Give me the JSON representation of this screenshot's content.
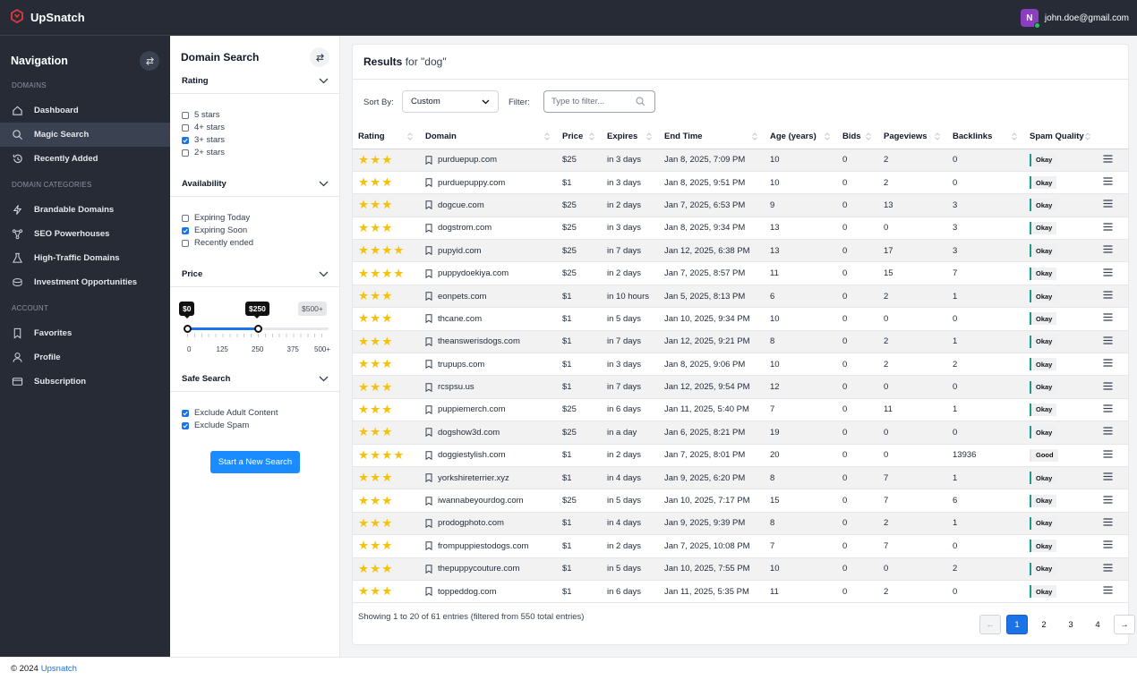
{
  "app": {
    "name": "UpSnatch"
  },
  "user": {
    "initial": "N",
    "email": "john.doe@gmail.com"
  },
  "nav": {
    "title": "Navigation",
    "sections": [
      {
        "label": "DOMAINS",
        "items": [
          {
            "label": "Dashboard",
            "icon": "home-icon"
          },
          {
            "label": "Magic Search",
            "icon": "search-icon",
            "active": true
          },
          {
            "label": "Recently Added",
            "icon": "history-icon"
          }
        ]
      },
      {
        "label": "DOMAIN CATEGORIES",
        "items": [
          {
            "label": "Brandable Domains",
            "icon": "lightning-icon"
          },
          {
            "label": "SEO Powerhouses",
            "icon": "network-icon"
          },
          {
            "label": "High-Traffic Domains",
            "icon": "flask-icon"
          },
          {
            "label": "Investment Opportunities",
            "icon": "coins-icon"
          }
        ]
      },
      {
        "label": "ACCOUNT",
        "items": [
          {
            "label": "Favorites",
            "icon": "bookmark-icon"
          },
          {
            "label": "Profile",
            "icon": "user-icon"
          },
          {
            "label": "Subscription",
            "icon": "card-icon"
          }
        ]
      }
    ]
  },
  "filters": {
    "title": "Domain Search",
    "rating": {
      "title": "Rating",
      "options": [
        {
          "label": "5 stars",
          "checked": false
        },
        {
          "label": "4+ stars",
          "checked": false
        },
        {
          "label": "3+ stars",
          "checked": true
        },
        {
          "label": "2+ stars",
          "checked": false
        }
      ]
    },
    "availability": {
      "title": "Availability",
      "options": [
        {
          "label": "Expiring Today",
          "checked": false
        },
        {
          "label": "Expiring Soon",
          "checked": true
        },
        {
          "label": "Recently ended",
          "checked": false
        }
      ]
    },
    "price": {
      "title": "Price",
      "min_label": "$0",
      "max_label": "$250",
      "cap_label": "$500+",
      "min": 0,
      "max": 250,
      "scale_max": 500,
      "ticks": [
        "0",
        "125",
        "250",
        "375",
        "500+"
      ]
    },
    "safe": {
      "title": "Safe Search",
      "options": [
        {
          "label": "Exclude Adult Content",
          "checked": true
        },
        {
          "label": "Exclude Spam",
          "checked": true
        }
      ]
    },
    "search_button": "Start a New Search"
  },
  "results": {
    "title": "Results",
    "query_text": "for \"dog\"",
    "sort_label": "Sort By:",
    "sort_value": "Custom",
    "filter_label": "Filter:",
    "filter_placeholder": "Type to filter...",
    "columns": [
      "Rating",
      "Domain",
      "Price",
      "Expires",
      "End Time",
      "Age (years)",
      "Bids",
      "Pageviews",
      "Backlinks",
      "Spam Quality"
    ],
    "rows": [
      {
        "rating": 3,
        "domain": "purduepup.com",
        "price": "$25",
        "expires": "in 3 days",
        "end": "Jan 8, 2025, 7:09 PM",
        "age": "10",
        "bids": "0",
        "views": "2",
        "links": "0",
        "spam": "Okay"
      },
      {
        "rating": 3,
        "domain": "purduepuppy.com",
        "price": "$1",
        "expires": "in 3 days",
        "end": "Jan 8, 2025, 9:51 PM",
        "age": "10",
        "bids": "0",
        "views": "2",
        "links": "0",
        "spam": "Okay"
      },
      {
        "rating": 3,
        "domain": "dogcue.com",
        "price": "$25",
        "expires": "in 2 days",
        "end": "Jan 7, 2025, 6:53 PM",
        "age": "9",
        "bids": "0",
        "views": "13",
        "links": "3",
        "spam": "Okay"
      },
      {
        "rating": 3,
        "domain": "dogstrom.com",
        "price": "$25",
        "expires": "in 3 days",
        "end": "Jan 8, 2025, 9:34 PM",
        "age": "13",
        "bids": "0",
        "views": "0",
        "links": "3",
        "spam": "Okay"
      },
      {
        "rating": 4,
        "domain": "pupyid.com",
        "price": "$25",
        "expires": "in 7 days",
        "end": "Jan 12, 2025, 6:38 PM",
        "age": "13",
        "bids": "0",
        "views": "17",
        "links": "3",
        "spam": "Okay"
      },
      {
        "rating": 4,
        "domain": "puppydoekiya.com",
        "price": "$25",
        "expires": "in 2 days",
        "end": "Jan 7, 2025, 8:57 PM",
        "age": "11",
        "bids": "0",
        "views": "15",
        "links": "7",
        "spam": "Okay"
      },
      {
        "rating": 3,
        "domain": "eonpets.com",
        "price": "$1",
        "expires": "in 10 hours",
        "end": "Jan 5, 2025, 8:13 PM",
        "age": "6",
        "bids": "0",
        "views": "2",
        "links": "1",
        "spam": "Okay"
      },
      {
        "rating": 3,
        "domain": "thcane.com",
        "price": "$1",
        "expires": "in 5 days",
        "end": "Jan 10, 2025, 9:34 PM",
        "age": "10",
        "bids": "0",
        "views": "0",
        "links": "0",
        "spam": "Okay"
      },
      {
        "rating": 3,
        "domain": "theanswerisdogs.com",
        "price": "$1",
        "expires": "in 7 days",
        "end": "Jan 12, 2025, 9:21 PM",
        "age": "8",
        "bids": "0",
        "views": "2",
        "links": "1",
        "spam": "Okay"
      },
      {
        "rating": 3,
        "domain": "trupups.com",
        "price": "$1",
        "expires": "in 3 days",
        "end": "Jan 8, 2025, 9:06 PM",
        "age": "10",
        "bids": "0",
        "views": "2",
        "links": "2",
        "spam": "Okay"
      },
      {
        "rating": 3,
        "domain": "rcspsu.us",
        "price": "$1",
        "expires": "in 7 days",
        "end": "Jan 12, 2025, 9:54 PM",
        "age": "12",
        "bids": "0",
        "views": "0",
        "links": "0",
        "spam": "Okay"
      },
      {
        "rating": 3,
        "domain": "puppiemerch.com",
        "price": "$25",
        "expires": "in 6 days",
        "end": "Jan 11, 2025, 5:40 PM",
        "age": "7",
        "bids": "0",
        "views": "11",
        "links": "1",
        "spam": "Okay"
      },
      {
        "rating": 3,
        "domain": "dogshow3d.com",
        "price": "$25",
        "expires": "in a day",
        "end": "Jan 6, 2025, 8:21 PM",
        "age": "19",
        "bids": "0",
        "views": "0",
        "links": "0",
        "spam": "Okay"
      },
      {
        "rating": 4,
        "domain": "doggiestylish.com",
        "price": "$1",
        "expires": "in 2 days",
        "end": "Jan 7, 2025, 8:01 PM",
        "age": "20",
        "bids": "0",
        "views": "0",
        "links": "13936",
        "spam": "Good"
      },
      {
        "rating": 3,
        "domain": "yorkshireterrier.xyz",
        "price": "$1",
        "expires": "in 4 days",
        "end": "Jan 9, 2025, 6:20 PM",
        "age": "8",
        "bids": "0",
        "views": "7",
        "links": "1",
        "spam": "Okay"
      },
      {
        "rating": 3,
        "domain": "iwannabeyourdog.com",
        "price": "$25",
        "expires": "in 5 days",
        "end": "Jan 10, 2025, 7:17 PM",
        "age": "15",
        "bids": "0",
        "views": "7",
        "links": "6",
        "spam": "Okay"
      },
      {
        "rating": 3,
        "domain": "prodogphoto.com",
        "price": "$1",
        "expires": "in 4 days",
        "end": "Jan 9, 2025, 9:39 PM",
        "age": "8",
        "bids": "0",
        "views": "2",
        "links": "1",
        "spam": "Okay"
      },
      {
        "rating": 3,
        "domain": "frompuppiestodogs.com",
        "price": "$1",
        "expires": "in 2 days",
        "end": "Jan 7, 2025, 10:08 PM",
        "age": "7",
        "bids": "0",
        "views": "7",
        "links": "0",
        "spam": "Okay"
      },
      {
        "rating": 3,
        "domain": "thepuppycouture.com",
        "price": "$1",
        "expires": "in 5 days",
        "end": "Jan 10, 2025, 7:55 PM",
        "age": "10",
        "bids": "0",
        "views": "0",
        "links": "2",
        "spam": "Okay"
      },
      {
        "rating": 3,
        "domain": "toppeddog.com",
        "price": "$1",
        "expires": "in 6 days",
        "end": "Jan 11, 2025, 5:35 PM",
        "age": "11",
        "bids": "0",
        "views": "2",
        "links": "0",
        "spam": "Okay"
      }
    ],
    "entries_text": "Showing 1 to 20 of 61 entries (filtered from 550 total entries)",
    "pagination": {
      "prev": "←",
      "next": "→",
      "pages": [
        "1",
        "2",
        "3",
        "4"
      ],
      "current": "1"
    }
  },
  "footer": {
    "copyright": "© 2024",
    "link": "Upsnatch"
  },
  "colors": {
    "accent": "#1a73e8",
    "star": "#f4c20d",
    "nav_bg": "#262b36",
    "brand_red": "#e0393e"
  }
}
